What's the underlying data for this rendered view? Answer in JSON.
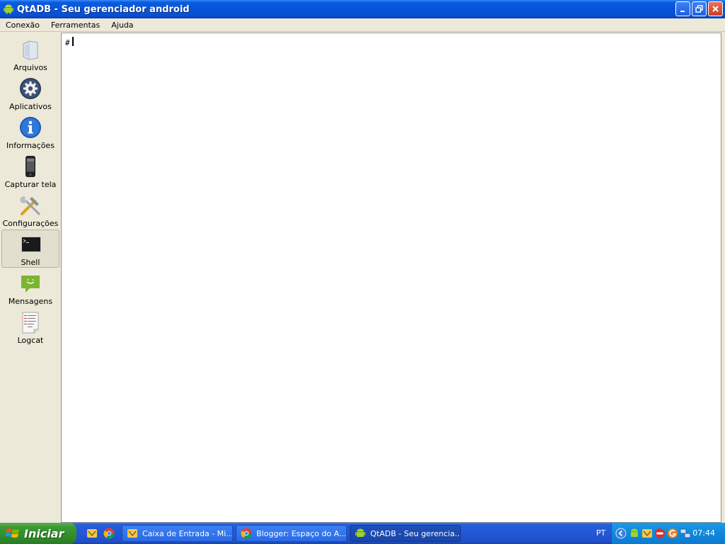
{
  "window": {
    "title": "QtADB - Seu gerenciador android"
  },
  "menu": [
    "Conexão",
    "Ferramentas",
    "Ajuda"
  ],
  "sidebar": {
    "items": [
      {
        "label": "Arquivos",
        "icon": "folder-icon"
      },
      {
        "label": "Aplicativos",
        "icon": "gear-icon"
      },
      {
        "label": "Informações",
        "icon": "info-icon"
      },
      {
        "label": "Capturar tela",
        "icon": "phone-icon"
      },
      {
        "label": "Configurações",
        "icon": "tools-icon"
      },
      {
        "label": "Shell",
        "icon": "terminal-icon",
        "active": true
      },
      {
        "label": "Mensagens",
        "icon": "message-icon"
      },
      {
        "label": "Logcat",
        "icon": "log-icon"
      }
    ]
  },
  "console": {
    "prompt": "#"
  },
  "taskbar": {
    "start_label": "Iniciar",
    "tasks": [
      {
        "label": "Caixa de Entrada - Mi...",
        "icon": "mail-icon"
      },
      {
        "label": "Blogger: Espaço do A...",
        "icon": "chrome-icon"
      },
      {
        "label": "QtADB - Seu gerencia...",
        "icon": "android-icon",
        "active": true
      }
    ],
    "language": "PT",
    "clock": "07:44"
  },
  "colors": {
    "titlebar": "#0854d8",
    "taskbar": "#245edc",
    "start": "#3c9a34",
    "tray": "#1188dc"
  }
}
